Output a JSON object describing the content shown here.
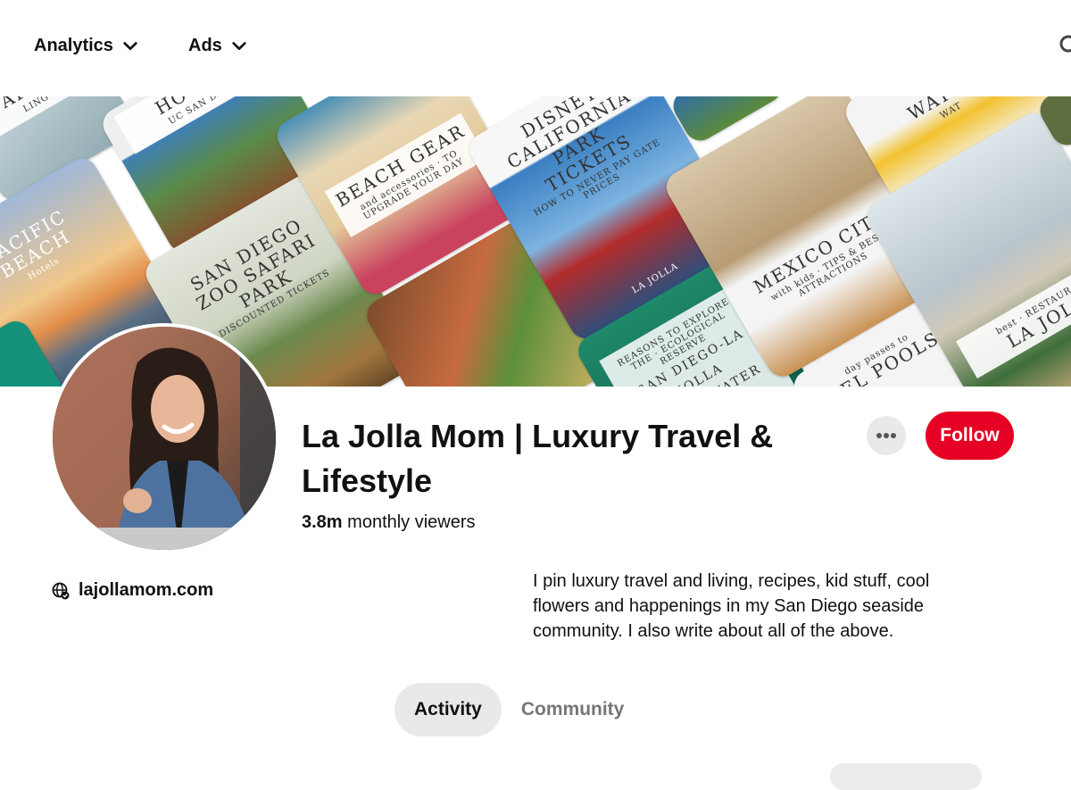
{
  "nav": {
    "analytics_label": "Analytics",
    "ads_label": "Ads"
  },
  "cover": {
    "tiles": [
      {
        "title": "APOR",
        "subtitle": "LING"
      },
      {
        "title": "HOTEL",
        "subtitle": "UC SAN DIE"
      },
      {
        "title": "PACIFIC BEACH",
        "subtitle": "Hotels"
      },
      {
        "title": "BEACH GEAR",
        "subtitle": "and accessories · TO UPGRADE YOUR DAY"
      },
      {
        "title": "SAN DIEGO ZOO SAFARI PARK",
        "subtitle": "DISCOUNTED TICKETS"
      },
      {
        "title": "DISNEY CALIFORNIA PARK TICKETS",
        "subtitle": "HOW TO NEVER PAY GATE PRICES"
      },
      {
        "title": "LA JOLLA",
        "subtitle": ""
      },
      {
        "title": "SAN DIEGO-LA JOLLA UNDERWATER PARK",
        "subtitle": "REASONS TO EXPLORE THE · ECOLOGICAL RESERVE"
      },
      {
        "title": "MEXICO CITY",
        "subtitle": "with kids · TIPS & BEST ATTRACTIONS"
      },
      {
        "title": "TEL POOLS",
        "subtitle": "day passes to"
      },
      {
        "title": "WATER",
        "subtitle": "WAT"
      },
      {
        "title": "LA JOLI",
        "subtitle": "best · RESTAURA"
      }
    ]
  },
  "profile": {
    "name": "La Jolla Mom | Luxury Travel & Lifestyle",
    "viewers_count": "3.8m",
    "viewers_label": "monthly viewers",
    "follow_label": "Follow",
    "more_label": "•••",
    "website": "lajollamom.com",
    "bio": "I pin luxury travel and living, recipes, kid stuff, cool flowers and happenings in my San Diego seaside community. I also write about all of the above."
  },
  "tabs": [
    {
      "label": "Activity",
      "active": true
    },
    {
      "label": "Community",
      "active": false
    }
  ],
  "colors": {
    "accent": "#e60023",
    "pill_bg": "#e9e9e9",
    "muted_text": "#767676"
  }
}
